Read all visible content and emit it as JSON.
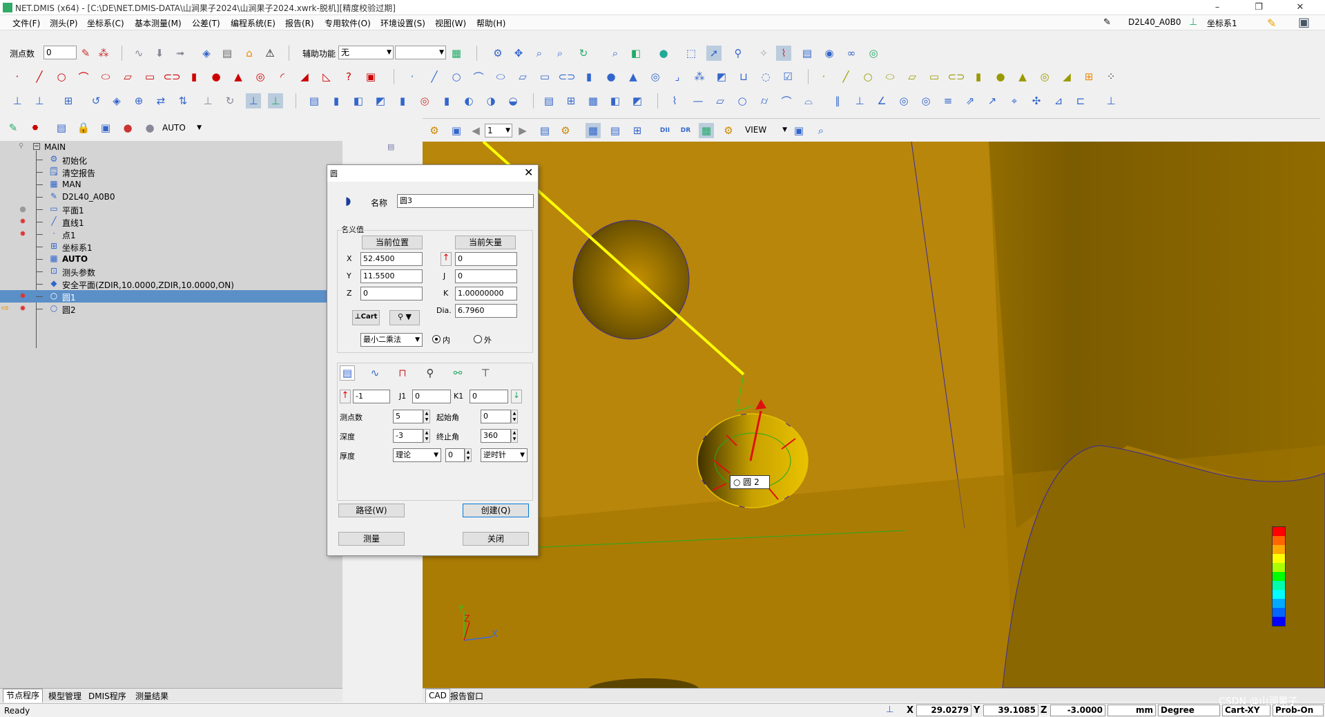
{
  "window": {
    "title": "NET.DMIS (x64) - [C:\\DE\\NET.DMIS-DATA\\山涧果子2024\\山涧果子2024.xwrk-脱机][精度校验过期]",
    "controls": [
      "–",
      "❐",
      "✕"
    ]
  },
  "menu": [
    "文件(F)",
    "测头(P)",
    "坐标系(C)",
    "基本测量(M)",
    "公差(T)",
    "编程系统(E)",
    "报告(R)",
    "专用软件(O)",
    "环境设置(S)",
    "视图(W)",
    "帮助(H)"
  ],
  "menu_right": {
    "probe": "D2L40_A0B0",
    "coord": "坐标系1"
  },
  "toolbar1": {
    "points_label": "测点数",
    "points_value": "0",
    "aux_label": "辅助功能",
    "aux_value": "无",
    "aux2_value": ""
  },
  "toolbar4": {
    "mode_value": "AUTO"
  },
  "cad_toolbar": {
    "page_value": "1",
    "view_value": "VIEW"
  },
  "tree": {
    "root": "MAIN",
    "items": [
      {
        "label": "初始化",
        "icon": "⚙",
        "bp": ""
      },
      {
        "label": "清空报告",
        "icon": "🗒",
        "bp": ""
      },
      {
        "label": "MAN",
        "icon": "▦",
        "bp": ""
      },
      {
        "label": "D2L40_A0B0",
        "icon": "✎",
        "bp": ""
      },
      {
        "label": "平面1",
        "icon": "▭",
        "bp": "●"
      },
      {
        "label": "直线1",
        "icon": "╱",
        "bp": "✹"
      },
      {
        "label": "点1",
        "icon": "·",
        "bp": "✹"
      },
      {
        "label": "坐标系1",
        "icon": "⊞",
        "bp": ""
      },
      {
        "label": "AUTO",
        "icon": "▦",
        "bp": ""
      },
      {
        "label": "测头参数",
        "icon": "⊡",
        "bp": ""
      },
      {
        "label": "安全平面(ZDIR,10.0000,ZDIR,10.0000,ON)",
        "icon": "◆",
        "bp": ""
      },
      {
        "label": "圆1",
        "icon": "○",
        "bp": "✹"
      },
      {
        "label": "圆2",
        "icon": "○",
        "bp": "✹"
      }
    ]
  },
  "left_tabs": [
    "节点程序",
    "模型管理",
    "DMIS程序",
    "测量结果"
  ],
  "cad_tabs": [
    "CAD",
    "报告窗口"
  ],
  "dialog": {
    "title": "圆",
    "name_label": "名称",
    "name_value": "圆3",
    "nominal_label": "名义值",
    "cur_pos_btn": "当前位置",
    "cur_vec_btn": "当前矢量",
    "x_label": "X",
    "x_value": "52.4500",
    "y_label": "Y",
    "y_value": "11.5500",
    "z_label": "Z",
    "z_value": "0",
    "i_value": "0",
    "j_label": "J",
    "j_value": "0",
    "k_label": "K",
    "k_value": "1.00000000",
    "dia_label": "Dia.",
    "dia_value": "6.7960",
    "cart_btn": "Cart",
    "fit_value": "最小二乘法",
    "inner_label": "内",
    "outer_label": "外",
    "i1_value": "-1",
    "j1_label": "J1",
    "j1_value": "0",
    "k1_label": "K1",
    "k1_value": "0",
    "pts_label": "测点数",
    "pts_value": "5",
    "start_label": "起始角",
    "start_value": "0",
    "depth_label": "深度",
    "depth_value": "-3",
    "end_label": "终止角",
    "end_value": "360",
    "thick_label": "厚度",
    "thick_mode": "理论",
    "thick_value": "0",
    "dir_value": "逆时针",
    "path_btn": "路径(W)",
    "create_btn": "创建(Q)",
    "measure_btn": "测量",
    "close_btn": "关闭"
  },
  "cad": {
    "hole_label": "圆 2",
    "axis_x": "X",
    "axis_y": "Y",
    "axis_z": "Z"
  },
  "status": {
    "ready": "Ready",
    "x_label": "X",
    "x_value": "29.0279",
    "y_label": "Y",
    "y_value": "39.1085",
    "z_label": "Z",
    "z_value": "-3.0000",
    "unit": "mm",
    "angle": "Degree",
    "cart": "Cart-XY",
    "probe": "Prob-On",
    "watermark": "CSDN @山涧果子"
  }
}
